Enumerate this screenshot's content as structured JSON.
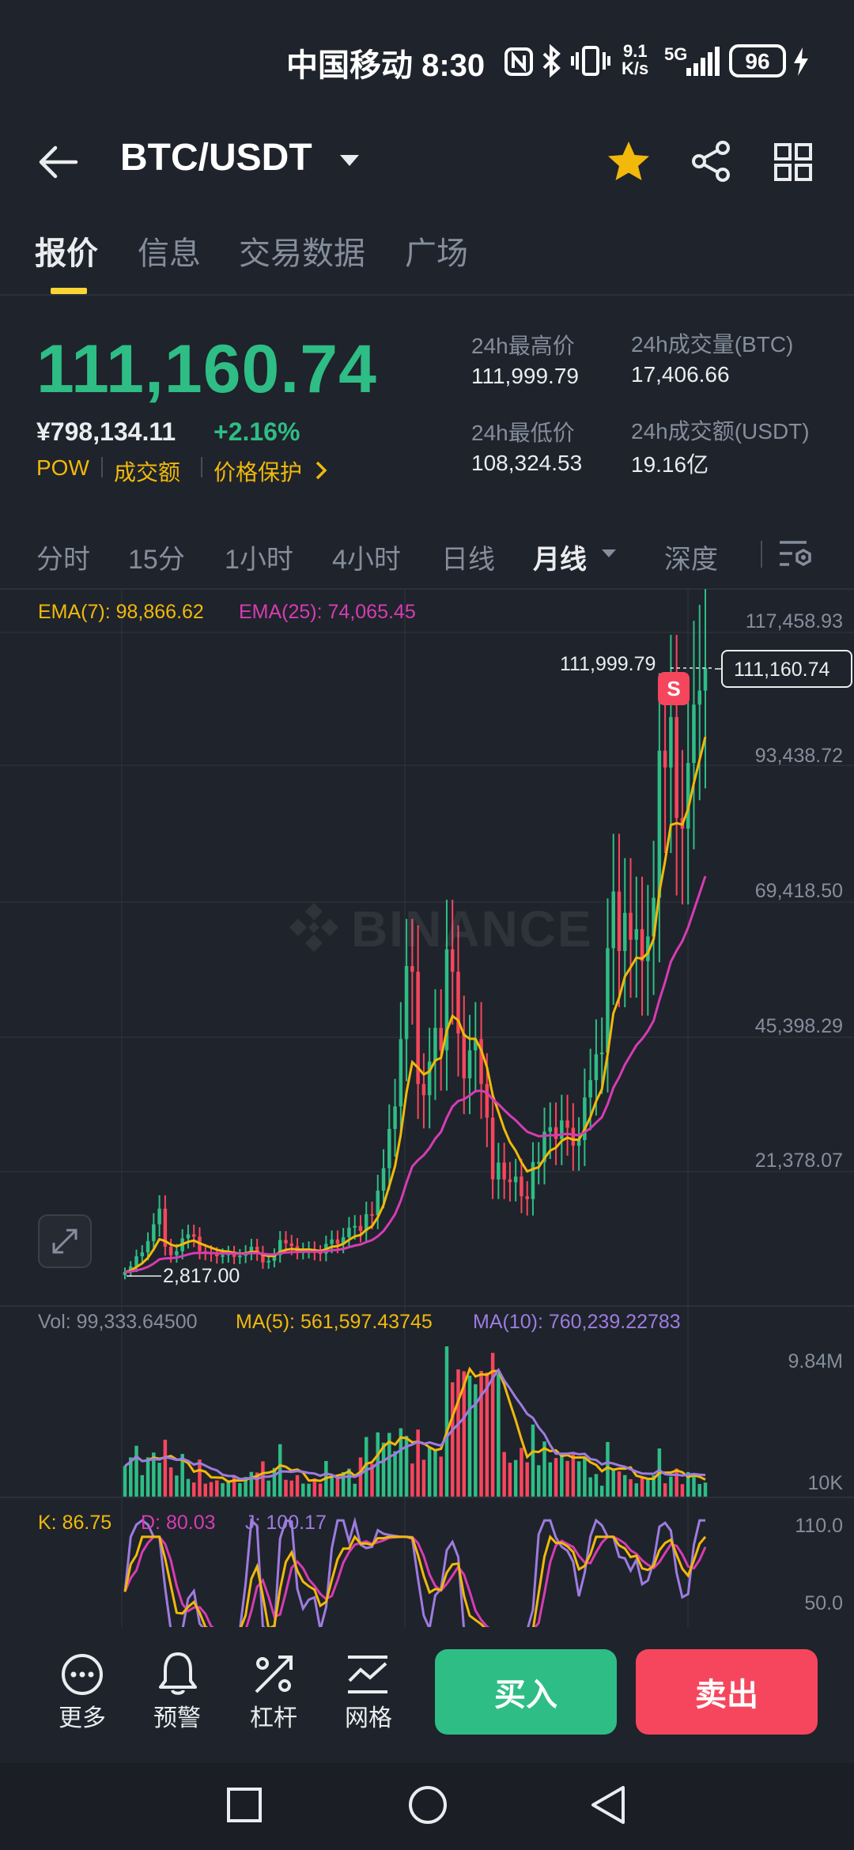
{
  "status_bar": {
    "carrier_time": "中国移动 8:30",
    "net_speed_top": "9.1",
    "net_speed_unit": "K/s",
    "network": "5G",
    "battery": "96"
  },
  "header": {
    "pair": "BTC/USDT",
    "icons": [
      "back-arrow-icon",
      "chevron-down-icon",
      "star-icon",
      "share-icon",
      "grid-icon"
    ],
    "favorite_color": "#f0b90b"
  },
  "tabs": [
    {
      "label": "报价",
      "active": true
    },
    {
      "label": "信息",
      "active": false
    },
    {
      "label": "交易数据",
      "active": false
    },
    {
      "label": "广场",
      "active": false
    }
  ],
  "price": {
    "last": "111,160.74",
    "cny": "¥798,134.11",
    "change": "+2.16%",
    "tags": [
      "POW",
      "成交额",
      "价格保护"
    ],
    "stats": {
      "high_label": "24h最高价",
      "high": "111,999.79",
      "low_label": "24h最低价",
      "low": "108,324.53",
      "vol_btc_label": "24h成交量(BTC)",
      "vol_btc": "17,406.66",
      "vol_usdt_label": "24h成交额(USDT)",
      "vol_usdt": "19.16亿"
    }
  },
  "intervals": [
    {
      "label": "分时",
      "active": false
    },
    {
      "label": "15分",
      "active": false
    },
    {
      "label": "1小时",
      "active": false
    },
    {
      "label": "4小时",
      "active": false
    },
    {
      "label": "日线",
      "active": false
    },
    {
      "label": "月线",
      "active": true
    },
    {
      "label": "深度",
      "active": false
    }
  ],
  "chart": {
    "ema7_label": "EMA(7): 98,866.62",
    "ema25_label": "EMA(25): 74,065.45",
    "axis": [
      "117,458.93",
      "93,438.72",
      "69,418.50",
      "45,398.29",
      "21,378.07"
    ],
    "high_marker": "111,999.79",
    "last_price_tag": "111,160.74",
    "low_marker": "2,817.00",
    "sell_marker": "S",
    "watermark": "BINANCE",
    "vol_label": "Vol: 99,333.64500",
    "ma5_label": "MA(5): 561,597.43745",
    "ma10_label": "MA(10): 760,239.22783",
    "vol_axis": [
      "9.84M",
      "10K"
    ],
    "k_label": "K: 86.75",
    "d_label": "D: 80.03",
    "j_label": "J: 100.17",
    "kdj_axis": [
      "110.0",
      "50.0"
    ],
    "up_color": "#2ebd85",
    "down_color": "#f6465d",
    "ema7_color": "#f0b90b",
    "ema25_color": "#d63cb4",
    "ma10_color": "#9d7ce0"
  },
  "chart_data": {
    "type": "candlestick",
    "title": "BTC/USDT 月线",
    "ylim": [
      0,
      117458.93
    ],
    "y_ticks": [
      21378.07,
      45398.29,
      69418.5,
      93438.72,
      117458.93
    ],
    "closes": [
      3500,
      4500,
      6300,
      7000,
      9000,
      12000,
      14800,
      8000,
      6500,
      7200,
      9500,
      10200,
      9800,
      7200,
      7000,
      6700,
      6300,
      6500,
      6900,
      6200,
      6400,
      7000,
      8000,
      6900,
      5200,
      5500,
      6500,
      9200,
      8600,
      8100,
      7200,
      7400,
      7600,
      7000,
      6800,
      8500,
      9300,
      8500,
      9700,
      11400,
      11700,
      10800,
      13800,
      13600,
      18000,
      22000,
      29000,
      33000,
      45000,
      58000,
      57000,
      37000,
      35000,
      41000,
      47000,
      43000,
      61000,
      57000,
      46000,
      38000,
      43000,
      45000,
      37000,
      31000,
      20000,
      23000,
      20000,
      19500,
      20500,
      17000,
      16500,
      23100,
      23100,
      28500,
      29300,
      27200,
      30500,
      29200,
      26000,
      27000,
      34600,
      37700,
      42300,
      42600,
      61200,
      71300,
      60700,
      67500,
      62700,
      64600,
      58900,
      63300,
      70200,
      96400,
      93400,
      102400,
      84400,
      82500,
      94200,
      104600,
      107100,
      111160
    ],
    "highs": [
      111999.79
    ],
    "lows": [
      2817.0
    ]
  }
}
